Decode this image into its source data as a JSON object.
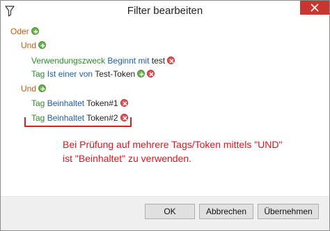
{
  "window": {
    "title": "Filter bearbeiten"
  },
  "tree": {
    "root_or": "Oder",
    "and1": "Und",
    "cond1": {
      "field": "Verwendungszweck",
      "operator": "Beginnt mit",
      "value": "test"
    },
    "cond2": {
      "field": "Tag",
      "operator": "Ist einer von",
      "value": "Test-Token"
    },
    "and2": "Und",
    "cond3": {
      "field": "Tag",
      "operator": "Beinhaltet",
      "value": "Token#1"
    },
    "cond4": {
      "field": "Tag",
      "operator": "Beinhaltet",
      "value": "Token#2"
    }
  },
  "annotation": {
    "line1": "Bei Prüfung auf mehrere Tags/Token mittels \"UND\"",
    "line2": "ist \"Beinhaltet\" zu verwenden."
  },
  "buttons": {
    "ok": "OK",
    "cancel": "Abbrechen",
    "apply": "Übernehmen"
  },
  "icons": {
    "title": "filter-icon",
    "close": "close-icon",
    "add": "add-icon",
    "remove": "remove-icon"
  },
  "colors": {
    "close_button": "#c7372f",
    "or_keyword": "#c55a11",
    "field": "#2e8b2e",
    "operator": "#1f5fa8",
    "annotation": "#e0141e",
    "add_icon": "#6ab04c",
    "remove_icon": "#e15656"
  }
}
